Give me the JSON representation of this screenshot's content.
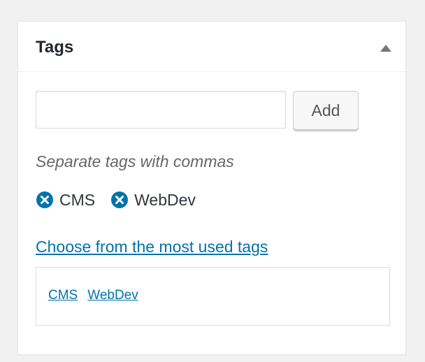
{
  "panel": {
    "title": "Tags",
    "toggle_icon": "triangle-up-icon"
  },
  "tag_input": {
    "value": "",
    "placeholder": ""
  },
  "add_button": {
    "label": "Add"
  },
  "hint": "Separate tags with commas",
  "tags": [
    {
      "label": "CMS",
      "remove_icon": "remove-circle-x-icon"
    },
    {
      "label": "WebDev",
      "remove_icon": "remove-circle-x-icon"
    }
  ],
  "most_used_link": "Choose from the most used tags",
  "tag_cloud": [
    {
      "label": "CMS"
    },
    {
      "label": "WebDev"
    }
  ],
  "colors": {
    "accent": "#0073aa",
    "text": "#32373c",
    "muted": "#666666",
    "icon_arrow": "#72777c"
  }
}
